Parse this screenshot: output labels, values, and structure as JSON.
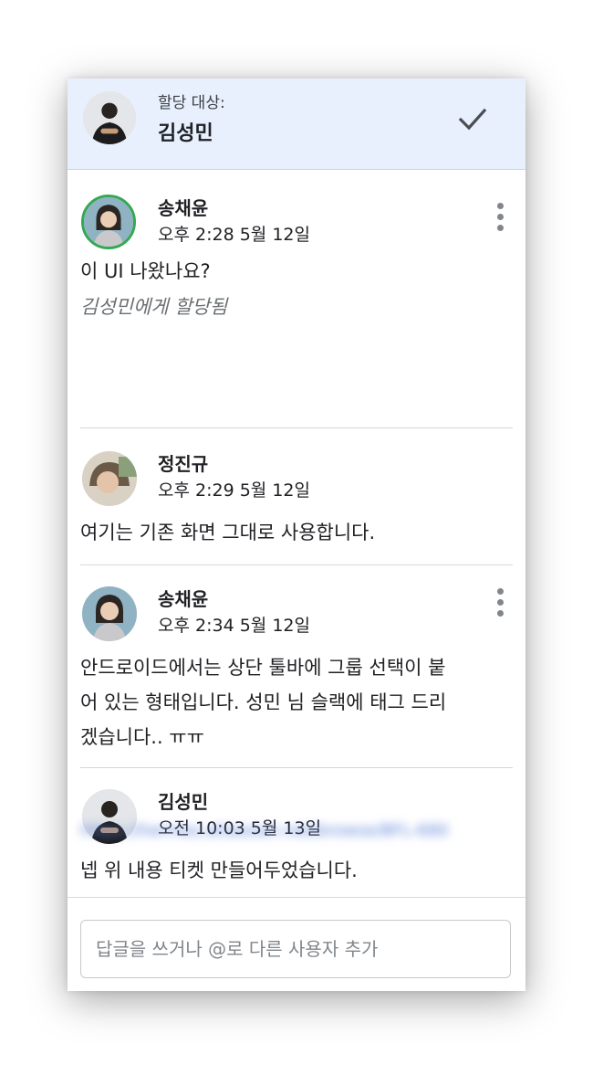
{
  "header": {
    "label": "할당 대상:",
    "assignee": "김성민",
    "confirm_icon": "check-icon"
  },
  "messages": [
    {
      "author": "송채윤",
      "time": "오후 2:28 5월 12일",
      "text": "이 UI 나왔나요?",
      "note": "김성민에게 할당됨",
      "has_more_menu": true,
      "avatar_ring_color": "#34a853"
    },
    {
      "author": "정진규",
      "time": "오후 2:29 5월 12일",
      "text": "여기는 기존 화면 그대로 사용합니다."
    },
    {
      "author": "송채윤",
      "time": "오후 2:34 5월 12일",
      "text_lines": [
        "안드로이드에서는 상단 툴바에 그룹 선택이 붙",
        "어 있는 형태입니다. 성민 님 슬랙에 태그 드리",
        "겠습니다.. ㅠㅠ"
      ],
      "has_more_menu": true
    },
    {
      "author": "김성민",
      "time": "오전 10:03 5월 13일",
      "text": "넵 위 내용 티켓 만들어두었습니다.",
      "link": "https://hermes.atlassian.net/browse/BFL-680"
    }
  ],
  "reply": {
    "placeholder": "답글을 쓰거나 @로 다른 사용자 추가"
  },
  "colors": {
    "header_bg": "#e8f0fe",
    "link": "#5a80d8",
    "muted": "#6b6f73"
  }
}
